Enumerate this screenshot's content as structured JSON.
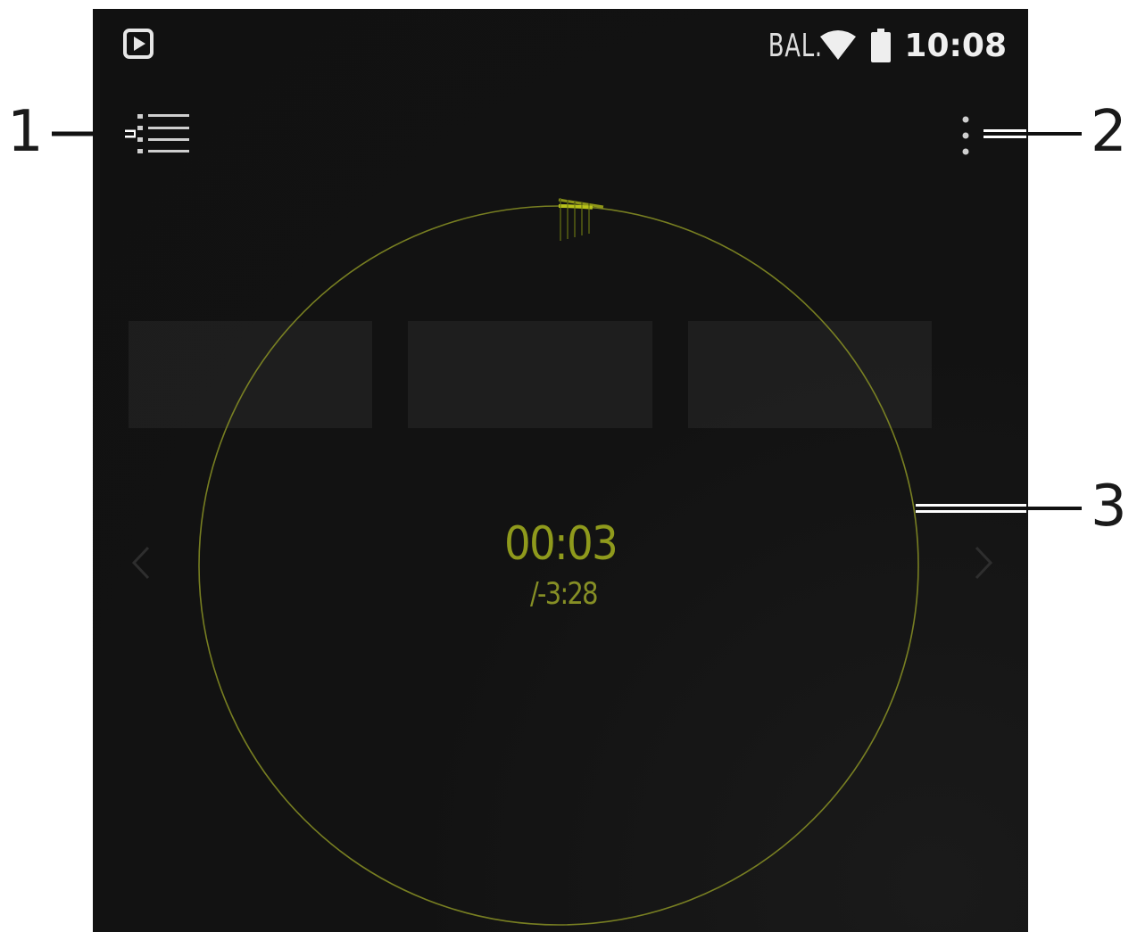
{
  "status_bar": {
    "app_icon": "play-store-icon",
    "output_label": "BAL.",
    "wifi_icon": "wifi-icon",
    "battery_icon": "battery-icon",
    "time": "10:08"
  },
  "toolbar": {
    "list_icon": "playlist-icon",
    "more_icon": "more-vertical-icon"
  },
  "player": {
    "elapsed": "00:03",
    "remaining": "/-3:28",
    "progress_fraction": 0.015,
    "prev_icon": "chevron-left-icon",
    "next_icon": "chevron-right-icon"
  },
  "callouts": {
    "one": "1",
    "two": "2",
    "three": "3"
  },
  "colors": {
    "background": "#121212",
    "accent": "#8f9a1c",
    "ring": "#8a9224"
  }
}
